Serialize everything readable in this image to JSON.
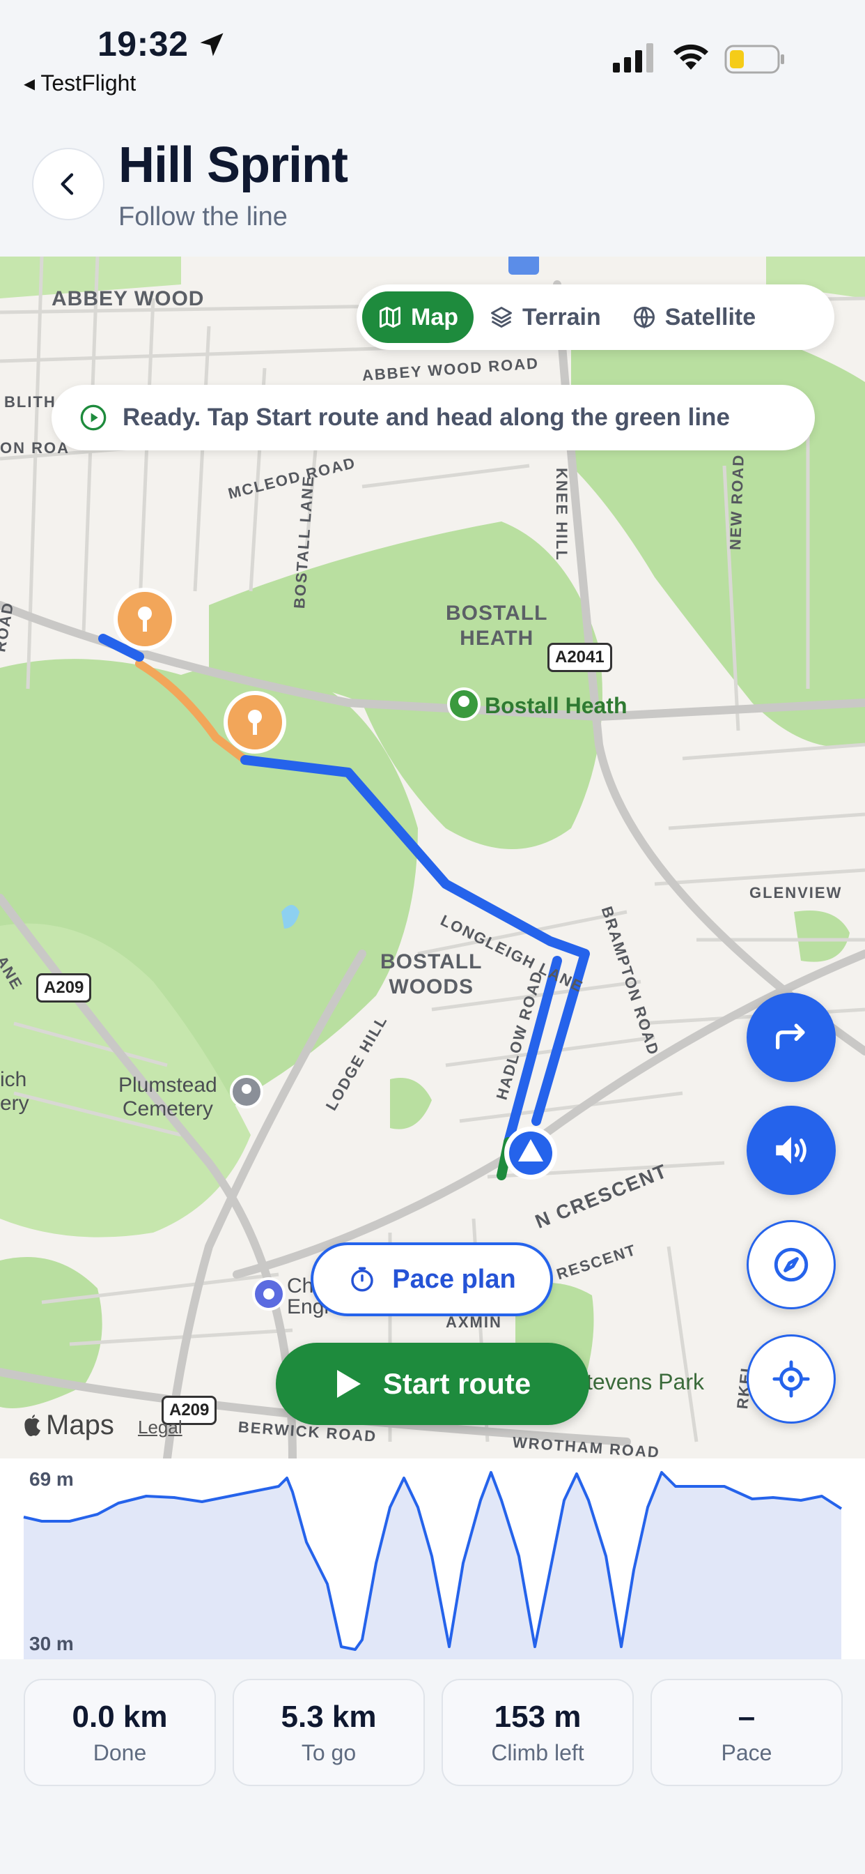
{
  "status_bar": {
    "time": "19:32",
    "back_app": "◂ TestFlight"
  },
  "header": {
    "title": "Hill Sprint",
    "subtitle": "Follow the line"
  },
  "map": {
    "modes": [
      {
        "label": "Map",
        "icon": "map-icon",
        "active": true
      },
      {
        "label": "Terrain",
        "icon": "layers-icon",
        "active": false
      },
      {
        "label": "Satellite",
        "icon": "globe-icon",
        "active": false
      }
    ],
    "banner": "Ready. Tap Start route and head along the green line",
    "labels": {
      "abbey_wood": "ABBEY WOOD",
      "abbey_wood_road": "ABBEY WOOD ROAD",
      "mcleod_road": "MCLEOD ROAD",
      "bostall_lane": "BOSTALL LANE",
      "knee_hill": "KNEE HILL",
      "new_road": "NEW ROAD",
      "bostall_heath_area": "BOSTALL\nHEATH",
      "a2041": "A2041",
      "bostall_heath_park": "Bostall Heath",
      "glenview": "GLENVIEW",
      "longleigh_lane": "LONGLEIGH LANE",
      "brampton_road": "BRAMPTON ROAD",
      "bostall_woods": "BOSTALL\nWOODS",
      "a209": "A209",
      "a209_b": "A209",
      "hadlow_road": "HADLOW ROAD",
      "lodge_hill": "LODGE HILL",
      "plumstead_cemetery": "Plumstead\nCemetery",
      "crescent": "N CRESCENT",
      "crescent_b": "RESCENT",
      "axmin": "AXMIN",
      "stevens_park": "tevens Park",
      "berwick_road": "BERWICK ROAD",
      "wrotham_road": "WROTHAM ROAD",
      "ch_engl": "Ch\nEngl",
      "ich_ery": "ich\nery",
      "blith": "BLITH",
      "on_roa": "ON ROA",
      "road_left": "ROAD",
      "ane": "ANE",
      "rkel": "RKEL"
    },
    "pace_plan_label": "Pace plan",
    "start_route_label": "Start route",
    "attribution": "Maps",
    "legal": "Legal"
  },
  "elevation": {
    "max_label": "69 m",
    "min_label": "30 m"
  },
  "stats": [
    {
      "value": "0.0 km",
      "label": "Done"
    },
    {
      "value": "5.3 km",
      "label": "To go"
    },
    {
      "value": "153 m",
      "label": "Climb left"
    },
    {
      "value": "–",
      "label": "Pace"
    }
  ],
  "colors": {
    "route_blue": "#2563eb",
    "accent_green": "#1e8b3d",
    "sprint_orange": "#f2a65a"
  }
}
